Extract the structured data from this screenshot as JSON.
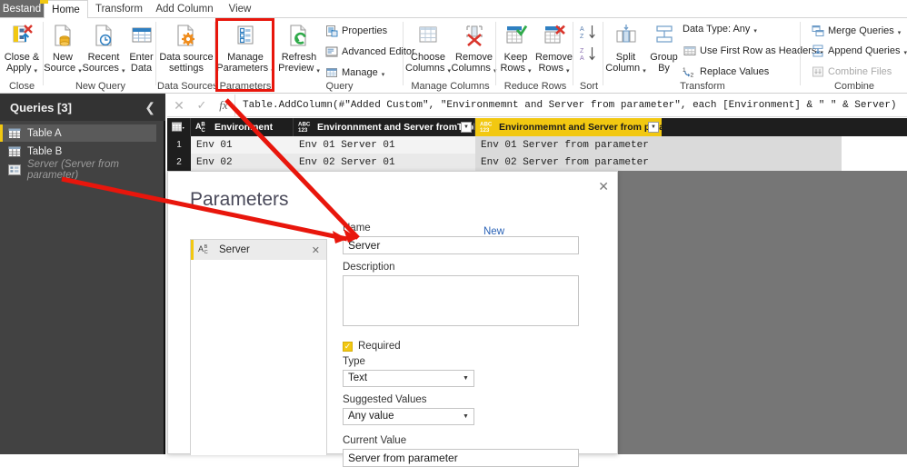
{
  "app": {
    "accent_yellow": "#f2c811",
    "annotation_red": "#e8160c"
  },
  "ribbon": {
    "tabs": [
      {
        "id": "file",
        "label": "Bestand"
      },
      {
        "id": "home",
        "label": "Home"
      },
      {
        "id": "transform",
        "label": "Transform"
      },
      {
        "id": "addcolumn",
        "label": "Add Column"
      },
      {
        "id": "view",
        "label": "View"
      }
    ],
    "groups": [
      {
        "name": "close",
        "label": "Close"
      },
      {
        "name": "new-query",
        "label": "New Query"
      },
      {
        "name": "data-sources",
        "label": "Data Sources"
      },
      {
        "name": "parameters",
        "label": "Parameters"
      },
      {
        "name": "query",
        "label": "Query"
      },
      {
        "name": "manage-columns",
        "label": "Manage Columns"
      },
      {
        "name": "reduce-rows",
        "label": "Reduce Rows"
      },
      {
        "name": "sort",
        "label": "Sort"
      },
      {
        "name": "transform",
        "label": "Transform"
      },
      {
        "name": "combine",
        "label": "Combine"
      }
    ],
    "buttons": {
      "close_apply": "Close &\nApply",
      "close_apply_l1": "Close &",
      "close_apply_l2": "Apply",
      "new_source_l1": "New",
      "new_source_l2": "Source",
      "recent_sources_l1": "Recent",
      "recent_sources_l2": "Sources",
      "enter_data_l1": "Enter",
      "enter_data_l2": "Data",
      "data_source_settings_l1": "Data source",
      "data_source_settings_l2": "settings",
      "manage_parameters_l1": "Manage",
      "manage_parameters_l2": "Parameters",
      "refresh_preview_l1": "Refresh",
      "refresh_preview_l2": "Preview",
      "properties": "Properties",
      "advanced_editor": "Advanced Editor",
      "manage": "Manage",
      "choose_columns_l1": "Choose",
      "choose_columns_l2": "Columns",
      "remove_columns_l1": "Remove",
      "remove_columns_l2": "Columns",
      "keep_rows_l1": "Keep",
      "keep_rows_l2": "Rows",
      "remove_rows_l1": "Remove",
      "remove_rows_l2": "Rows",
      "split_column_l1": "Split",
      "split_column_l2": "Column",
      "group_by_l1": "Group",
      "group_by_l2": "By",
      "data_type": "Data Type: Any",
      "use_first_row_as_headers": "Use First Row as Headers",
      "replace_values": "Replace Values",
      "merge_queries": "Merge Queries",
      "append_queries": "Append Queries",
      "combine_files": "Combine Files"
    }
  },
  "queries_pane": {
    "title": "Queries [3]",
    "collapse_icon": "chevron-left-icon",
    "items": [
      {
        "label": "Table A",
        "icon": "table-icon",
        "selected": true,
        "ghost": false
      },
      {
        "label": "Table B",
        "icon": "table-icon",
        "selected": false,
        "ghost": false
      },
      {
        "label": "Server (Server from parameter)",
        "icon": "parameter-icon",
        "selected": false,
        "ghost": true
      }
    ]
  },
  "formula_bar": {
    "cancel_icon": "x-icon",
    "accept_icon": "check-icon",
    "fx_icon": "fx-icon",
    "formula": "Table.AddColumn(#\"Added Custom\", \"Environmemnt and Server from parameter\", each [Environment] & \" \" & Server)"
  },
  "grid": {
    "corner_icon": "select-all-icon",
    "columns": [
      {
        "header": "Environment",
        "type_icon": "ABC-text-icon",
        "highlighted": false,
        "has_dropdown": false
      },
      {
        "header": "Environnment and Server fromTable B",
        "type_icon": "ABC123-any-icon",
        "highlighted": false,
        "has_dropdown": true
      },
      {
        "header": "Environmemnt and Server from parameter",
        "type_icon": "ABC123-any-icon",
        "highlighted": true,
        "has_dropdown": true
      }
    ],
    "rows": [
      {
        "num": "1",
        "cells": [
          "Env 01",
          "Env 01 Server 01",
          "Env 01 Server from parameter"
        ]
      },
      {
        "num": "2",
        "cells": [
          "Env 02",
          "Env 02 Server 01",
          "Env 02 Server from parameter"
        ]
      }
    ]
  },
  "dialog": {
    "title": "Parameters",
    "close_icon": "close-icon",
    "new_link": "New",
    "list": [
      {
        "label": "Server",
        "icon": "ABC-text-icon",
        "remove_icon": "x-icon",
        "selected": true
      }
    ],
    "fields": {
      "name_label": "Name",
      "name_value": "Server",
      "description_label": "Description",
      "description_value": "",
      "description_placeholder": "",
      "required_label": "Required",
      "required_checked": true,
      "type_label": "Type",
      "type_value": "Text",
      "suggested_values_label": "Suggested Values",
      "suggested_values_value": "Any value",
      "current_value_label": "Current Value",
      "current_value_value": "Server from parameter"
    }
  },
  "annotations": {
    "arrow_1_name": "arrow-from-server-query-to-dialog",
    "arrow_2_name": "arrow-from-manage-parameters-to-name-field"
  }
}
